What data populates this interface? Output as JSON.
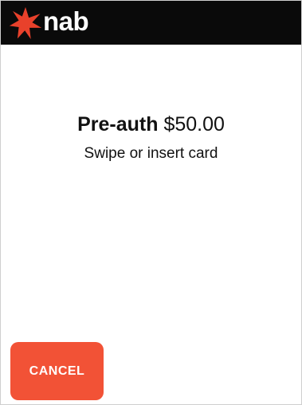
{
  "header": {
    "brand": "nab",
    "logo_icon": "nab-star-icon",
    "background_color": "#0a0a0a",
    "logo_color": "#e8412b"
  },
  "main": {
    "transaction_label": "Pre-auth",
    "amount": "$50.00",
    "instruction": "Swipe or insert card"
  },
  "actions": {
    "cancel_label": "CANCEL",
    "cancel_color": "#f25236"
  }
}
